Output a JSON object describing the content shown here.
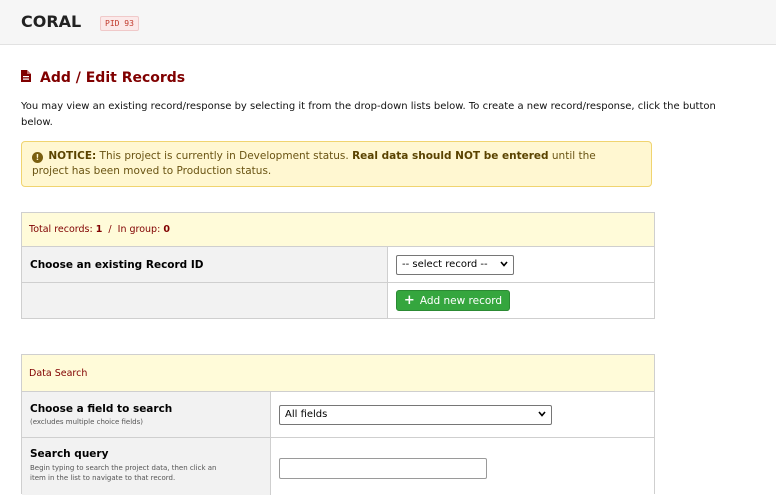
{
  "header": {
    "project_title": "CORAL",
    "pid_badge": "PID 93"
  },
  "page": {
    "title": "Add / Edit Records",
    "intro_line1": "You may view an existing record/response by selecting it from the drop-down lists below. To create a new record/response, click the button",
    "intro_line2": "below."
  },
  "notice": {
    "prefix": "NOTICE:",
    "text1": " This project is currently in Development status. ",
    "bold": "Real data should NOT be entered",
    "text2": " until the",
    "line2": "project has been moved to Production status."
  },
  "records": {
    "total_label": "Total records: ",
    "total_value": "1",
    "separator": "  /  ",
    "group_label": "In group: ",
    "group_value": "0",
    "choose_label": "Choose an existing Record ID",
    "select_value": "-- select record --",
    "add_button": "Add new record"
  },
  "search": {
    "header": "Data Search",
    "field_label": "Choose a field to search",
    "field_sublabel": "(excludes multiple choice fields)",
    "field_value": "All fields",
    "query_label": "Search query",
    "query_sublabel_1": "Begin typing to search the project data, then click an",
    "query_sublabel_2": "item in the list to navigate to that record.",
    "query_value": ""
  },
  "colors": {
    "accent": "#800000",
    "notice_bg": "#fff7d1",
    "table_header_bg": "#fffbd9",
    "button_green": "#35a63e"
  },
  "icons": {
    "title_icon": "file-icon",
    "notice_icon": "exclamation-circle-icon",
    "add_icon": "plus-icon",
    "dropdown_icon": "chevron-down-icon"
  }
}
